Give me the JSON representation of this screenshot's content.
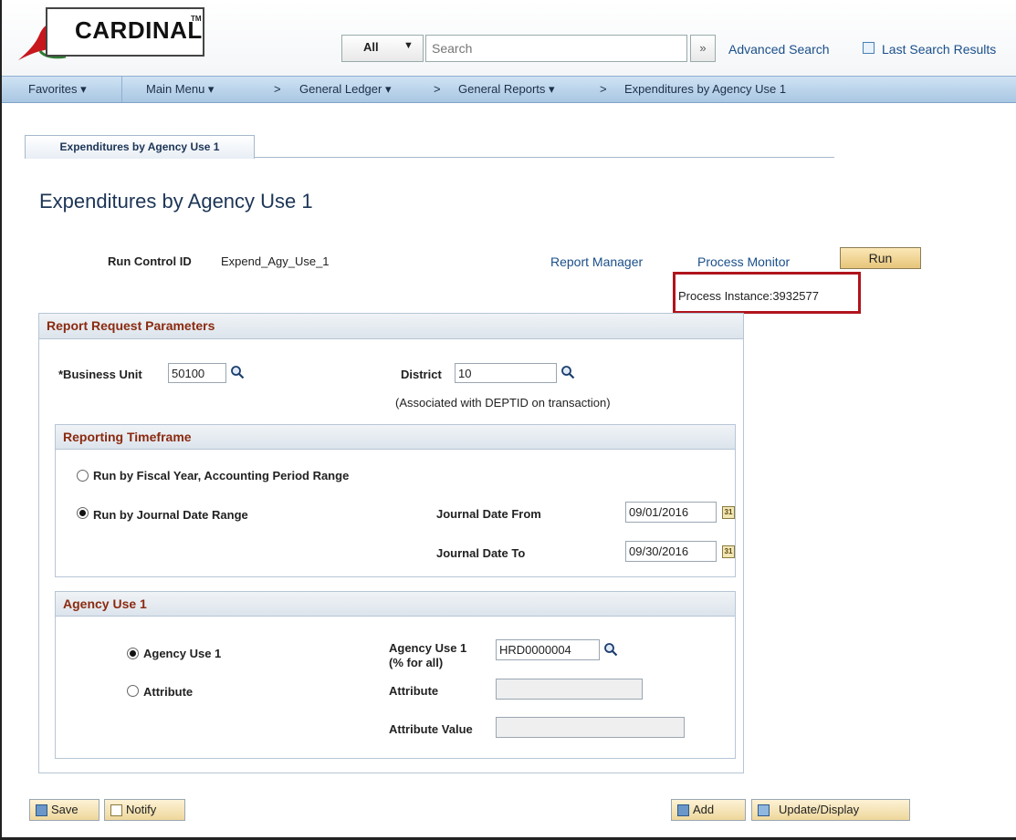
{
  "header": {
    "logo_text": "CARDINAL",
    "logo_mark": "TM",
    "search_scope": "All",
    "search_placeholder": "Search",
    "search_go_symbol": "»",
    "advanced_search": "Advanced Search",
    "last_search_results": "Last Search Results"
  },
  "nav": {
    "favorites": "Favorites ▾",
    "main_menu": "Main Menu ▾",
    "sep": ">",
    "general_ledger": "General Ledger ▾",
    "general_reports": "General Reports ▾",
    "current": "Expenditures by Agency Use 1"
  },
  "tab": {
    "label": "Expenditures by Agency Use 1"
  },
  "page": {
    "title": "Expenditures by Agency Use 1",
    "run_control_label": "Run Control ID",
    "run_control_value": "Expend_Agy_Use_1",
    "report_manager": "Report Manager",
    "process_monitor": "Process Monitor",
    "run_button": "Run",
    "process_instance": "Process Instance:3932577"
  },
  "report_params": {
    "title": "Report Request Parameters",
    "business_unit_label": "*Business Unit",
    "business_unit_value": "50100",
    "district_label": "District",
    "district_value": "10",
    "district_note": "(Associated with DEPTID on transaction)"
  },
  "timeframe": {
    "title": "Reporting Timeframe",
    "option_fiscal": "Run by Fiscal Year, Accounting Period Range",
    "option_journal": "Run by Journal Date Range",
    "selected": "journal",
    "date_from_label": "Journal Date From",
    "date_from_value": "09/01/2016",
    "date_to_label": "Journal Date To",
    "date_to_value": "09/30/2016",
    "calendar_glyph": "31"
  },
  "agency": {
    "title": "Agency Use 1",
    "option_agency": "Agency Use 1",
    "option_attribute": "Attribute",
    "selected": "agency",
    "agency_use_label": "Agency Use 1",
    "agency_use_sublabel": "(% for all)",
    "agency_use_value": "HRD0000004",
    "attribute_label": "Attribute",
    "attribute_value": "",
    "attribute_value_label": "Attribute Value",
    "attribute_value_value": ""
  },
  "footer": {
    "save": "Save",
    "notify": "Notify",
    "add": "Add",
    "update_display": "Update/Display"
  },
  "colors": {
    "link": "#1a4f8a",
    "group_title": "#8b2a10",
    "highlight_box": "#b0141c",
    "nav_bar": "#b9d3ec"
  }
}
